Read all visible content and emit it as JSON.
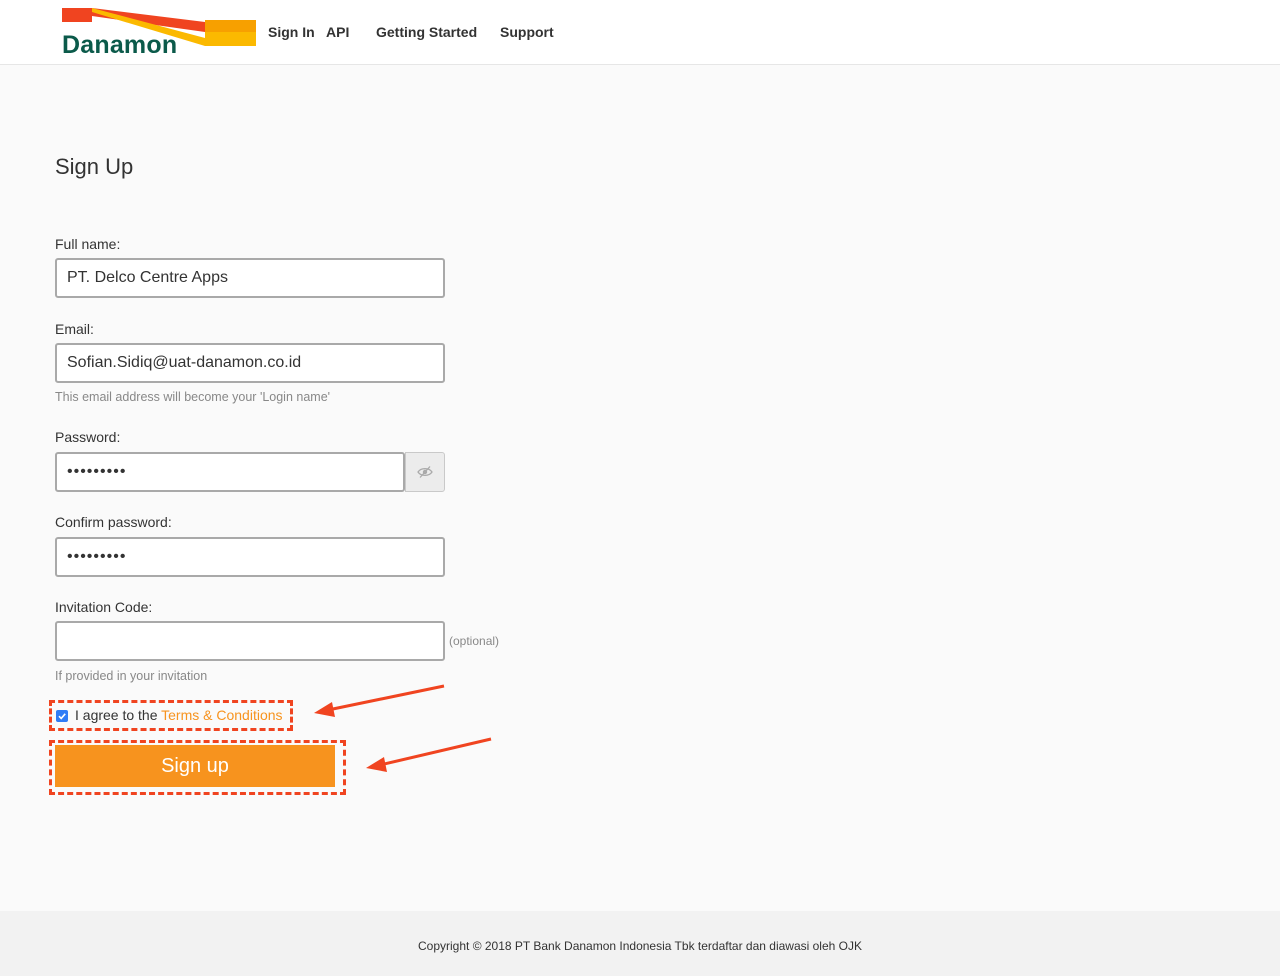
{
  "brand": {
    "name": "Danamon",
    "colors": {
      "green": "#0b5a4a",
      "orange": "#f7931e",
      "red_orange": "#f04420",
      "yellow": "#fbb900"
    }
  },
  "nav": {
    "sign_in": "Sign In",
    "api": "API",
    "getting_started": "Getting Started",
    "support": "Support"
  },
  "form": {
    "title": "Sign Up",
    "full_name": {
      "label": "Full name:",
      "value": "PT. Delco Centre Apps"
    },
    "email": {
      "label": "Email:",
      "value": "Sofian.Sidiq@uat-danamon.co.id",
      "hint": "This email address will become your 'Login name'"
    },
    "password": {
      "label": "Password:",
      "value": "•••••••••",
      "toggle_icon": "eye-slash-icon"
    },
    "confirm_password": {
      "label": "Confirm password:",
      "value": "•••••••••"
    },
    "invitation_code": {
      "label": "Invitation Code:",
      "value": "",
      "optional": "(optional)",
      "hint": "If provided in your invitation"
    },
    "agree": {
      "prefix": "I agree to the ",
      "link": "Terms & Conditions",
      "checked": true
    },
    "submit_label": "Sign up"
  },
  "footer": {
    "copyright": "Copyright © 2018 PT Bank Danamon Indonesia Tbk terdaftar dan diawasi oleh OJK"
  }
}
